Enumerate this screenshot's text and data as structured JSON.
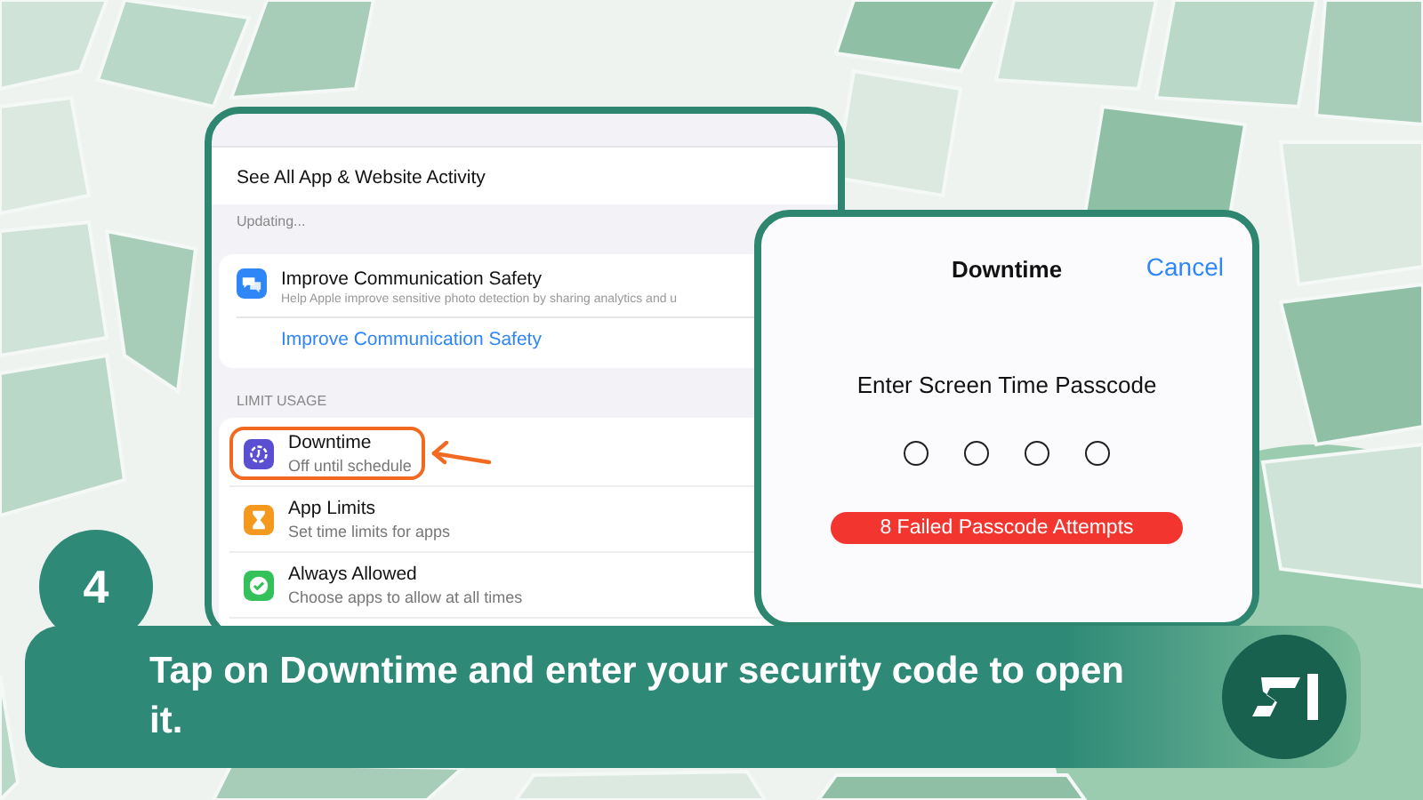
{
  "settings_screen": {
    "activity_link": "See All App & Website Activity",
    "status": "Updating...",
    "safety": {
      "kind": "communication",
      "title": "Improve Communication Safety",
      "description": "Help Apple improve sensitive photo detection by sharing analytics and u",
      "link": "Improve Communication Safety"
    },
    "section_header": "LIMIT USAGE",
    "rows": [
      {
        "kind": "downtime",
        "title": "Downtime",
        "subtitle": "Off until schedule",
        "highlighted": true
      },
      {
        "kind": "app-limits",
        "title": "App Limits",
        "subtitle": "Set time limits for apps",
        "highlighted": false
      },
      {
        "kind": "always-allowed",
        "title": "Always Allowed",
        "subtitle": "Choose apps to allow at all times",
        "highlighted": false
      }
    ]
  },
  "passcode_screen": {
    "title": "Downtime",
    "cancel": "Cancel",
    "prompt": "Enter Screen Time Passcode",
    "dots": [
      {
        "filled": false
      },
      {
        "filled": false
      },
      {
        "filled": false
      },
      {
        "filled": false
      }
    ],
    "error": "8 Failed Passcode Attempts"
  },
  "step": {
    "number": "4",
    "caption": "Tap on Downtime and enter your security code to open it."
  }
}
